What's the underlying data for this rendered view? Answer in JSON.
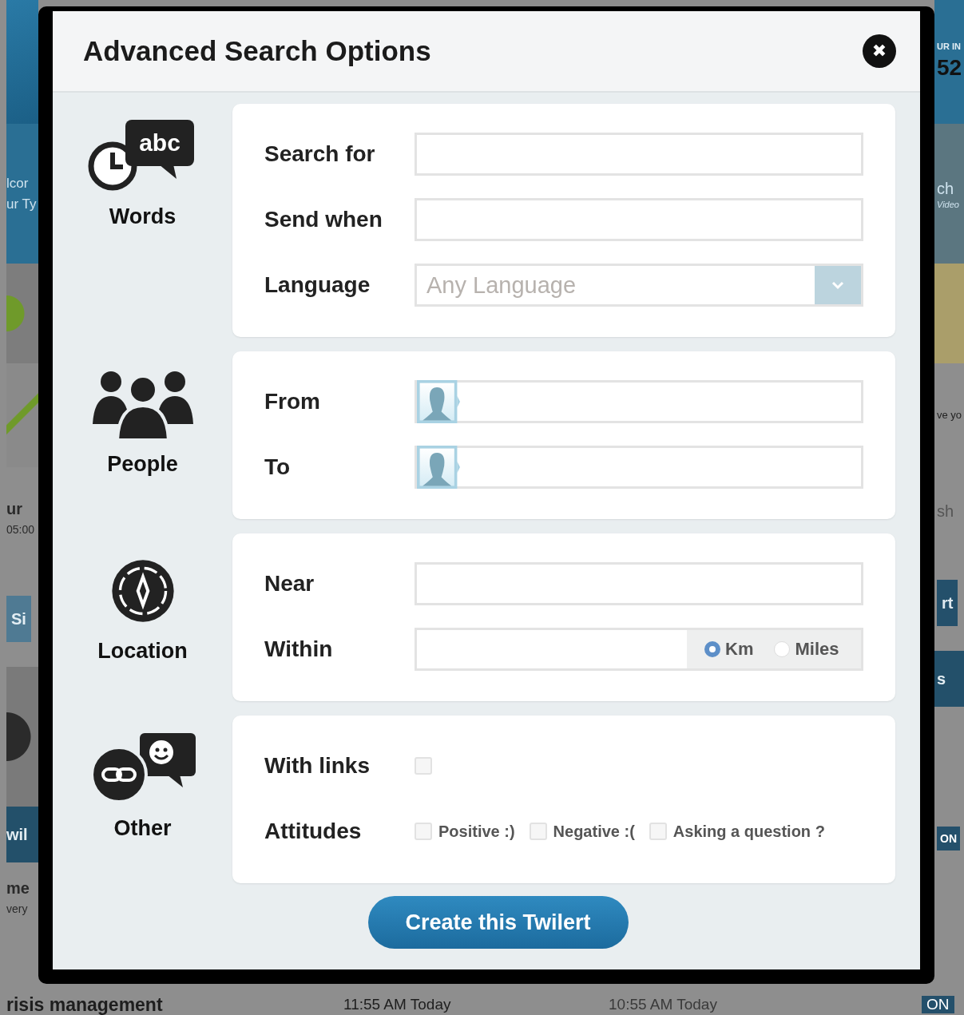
{
  "background": {
    "left": [
      {
        "kind": "logo"
      },
      {
        "kind": "band",
        "texts": [
          "lcor",
          "ur Ty"
        ]
      },
      {
        "kind": "avatar"
      },
      {
        "kind": "check"
      },
      {
        "kind": "plain",
        "texts": [
          "ur",
          "05:00"
        ]
      },
      {
        "kind": "button",
        "texts": [
          "Si"
        ]
      },
      {
        "kind": "dark"
      },
      {
        "kind": "band2",
        "texts": [
          "wil"
        ]
      },
      {
        "kind": "plain2",
        "texts": [
          "me",
          "very"
        ]
      }
    ],
    "right": [
      {
        "kind": "top",
        "texts": [
          "UR IN",
          "52"
        ]
      },
      {
        "kind": "band",
        "texts": [
          "ch",
          "Video"
        ]
      },
      {
        "kind": "banner"
      },
      {
        "kind": "plain",
        "texts": [
          "ve yo"
        ]
      },
      {
        "kind": "input",
        "texts": [
          "sh"
        ]
      },
      {
        "kind": "button",
        "texts": [
          "rt"
        ]
      },
      {
        "kind": "band2",
        "texts": [
          "s"
        ]
      },
      {
        "kind": "toggle",
        "texts": [
          "ON"
        ]
      }
    ],
    "bottom": [
      "risis management",
      "11:55 AM Today",
      "10:55 AM Today",
      "ON"
    ]
  },
  "dialog": {
    "title": "Advanced Search Options",
    "close": "✖",
    "sections": [
      {
        "label": "Words",
        "kind": "words",
        "icon_text": "abc",
        "fields": [
          {
            "kind": "text",
            "label": "Search for"
          },
          {
            "kind": "text",
            "label": "Send when"
          },
          {
            "kind": "select",
            "label": "Language",
            "value": "Any Language"
          }
        ]
      },
      {
        "label": "People",
        "kind": "people",
        "fields": [
          {
            "kind": "person",
            "label": "From"
          },
          {
            "kind": "person",
            "label": "To"
          }
        ]
      },
      {
        "label": "Location",
        "kind": "location",
        "fields": [
          {
            "kind": "text",
            "label": "Near"
          },
          {
            "kind": "distance",
            "label": "Within",
            "options": [
              {
                "label": "Km",
                "selected": true
              },
              {
                "label": "Miles",
                "selected": false
              }
            ]
          }
        ]
      },
      {
        "label": "Other",
        "kind": "other",
        "fields": [
          {
            "kind": "checkbox",
            "label": "With links",
            "checked": false
          },
          {
            "kind": "checkgroup",
            "label": "Attitudes",
            "options": [
              {
                "label": "Positive :)",
                "checked": false
              },
              {
                "label": "Negative :(",
                "checked": false
              },
              {
                "label": "Asking a question ?",
                "checked": false
              }
            ]
          }
        ]
      }
    ],
    "button": "Create this Twilert"
  }
}
